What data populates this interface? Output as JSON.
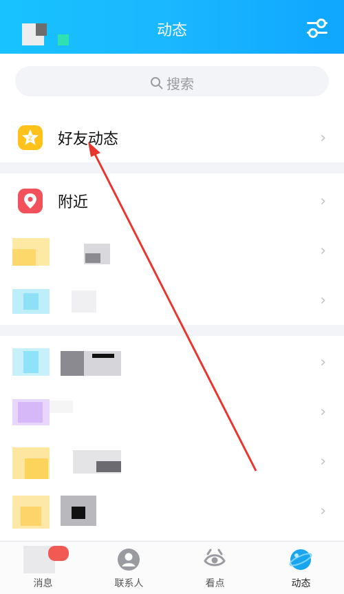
{
  "header": {
    "title": "动态"
  },
  "search": {
    "placeholder": "搜索"
  },
  "rows": [
    {
      "label": "好友动态"
    },
    {
      "label": "附近"
    }
  ],
  "tabs": [
    {
      "label": "消息"
    },
    {
      "label": "联系人"
    },
    {
      "label": "看点"
    },
    {
      "label": "动态"
    }
  ],
  "colors": {
    "header": "#1ab7ff",
    "friend_icon": "#ffc21a",
    "nearby_icon": "#f2505a"
  },
  "icons": {
    "settings": "sliders-icon",
    "search": "search-icon",
    "chevron": "chevron-right-icon"
  }
}
